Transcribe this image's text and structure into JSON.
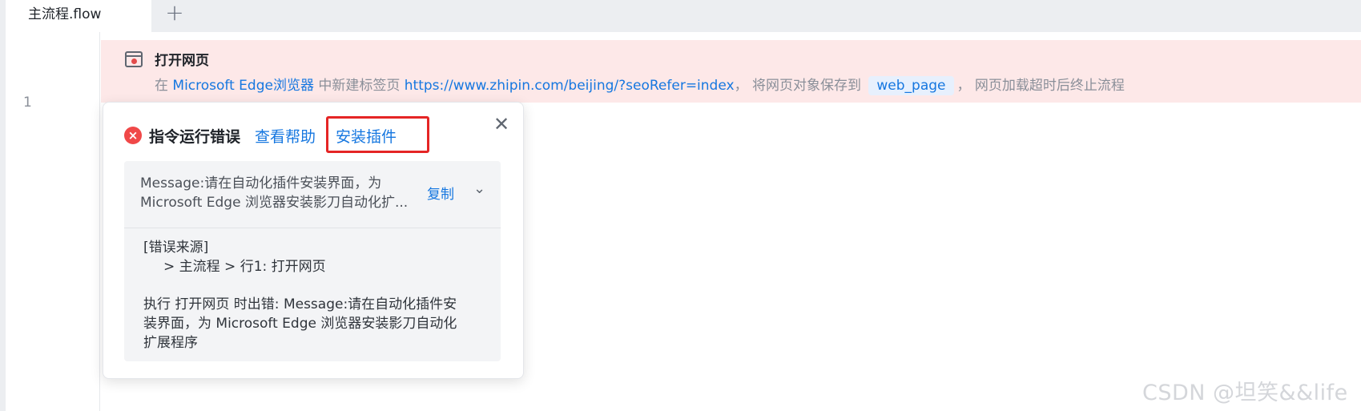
{
  "tabs": [
    {
      "label": "主流程.flow",
      "active": true
    }
  ],
  "add_tab_icon": "plus-icon",
  "line_number": "1",
  "flow_row": {
    "icon": "browser-error-icon",
    "title": "打开网页",
    "desc": {
      "prefix": "在 ",
      "browser": "Microsoft Edge浏览器",
      "mid": " 中新建标签页 ",
      "url": "https://www.zhipin.com/beijing/?seoRefer=index",
      "sep": "， 将网页对象保存到 ",
      "variable": "web_page",
      "suffix": "， 网页加载超时后终止流程"
    }
  },
  "error_popup": {
    "icon": "error-circle-icon",
    "title": "指令运行错误",
    "help_link": "查看帮助",
    "install_link": "安装插件",
    "close_icon": "close-icon",
    "message_line1": "Message:请在自动化插件安装界面，为",
    "message_line2": "Microsoft Edge 浏览器安装影刀自动化扩...",
    "copy_label": "复制",
    "expand_icon": "chevron-down-icon",
    "detail_source_label": "[错误来源]",
    "detail_source_path": "> 主流程 > 行1: 打开网页",
    "detail_exec_line1": "执行 打开网页 时出错: Message:请在自动化插件安",
    "detail_exec_line2": "装界面，为 Microsoft Edge 浏览器安装影刀自动化",
    "detail_exec_line3": "扩展程序"
  },
  "watermark": "CSDN @坦笑&&life",
  "colors": {
    "link": "#1677e0",
    "error": "#f04848",
    "row_error_bg": "#fde8e8",
    "highlight_box": "#e52525"
  }
}
